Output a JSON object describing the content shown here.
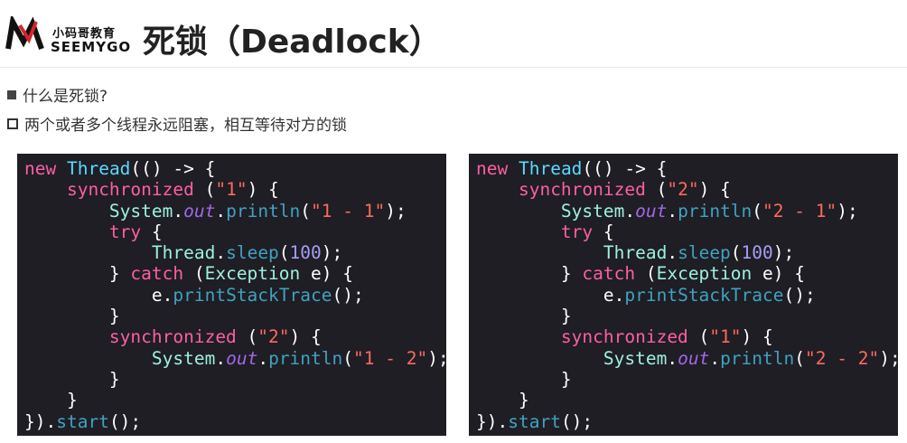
{
  "logo": {
    "cn": "小码哥教育",
    "en": "SEEMYGO"
  },
  "title": "死锁（Deadlock）",
  "bullets": [
    "什么是死锁?",
    "两个或者多个线程永远阻塞，相互等待对方的锁"
  ],
  "code_left": {
    "first_lock": "\"1\"",
    "first_msg": "\"1 - 1\"",
    "sleep_ms": "100",
    "second_lock": "\"2\"",
    "second_msg": "\"1 - 2\""
  },
  "code_right": {
    "first_lock": "\"2\"",
    "first_msg": "\"2 - 1\"",
    "sleep_ms": "100",
    "second_lock": "\"1\"",
    "second_msg": "\"2 - 2\""
  },
  "colors": {
    "code_bg": "#1e1e24",
    "keyword": "#fc5fa3",
    "string": "#fc6a5d",
    "number": "#a79df8",
    "type": "#5dd8ff"
  }
}
